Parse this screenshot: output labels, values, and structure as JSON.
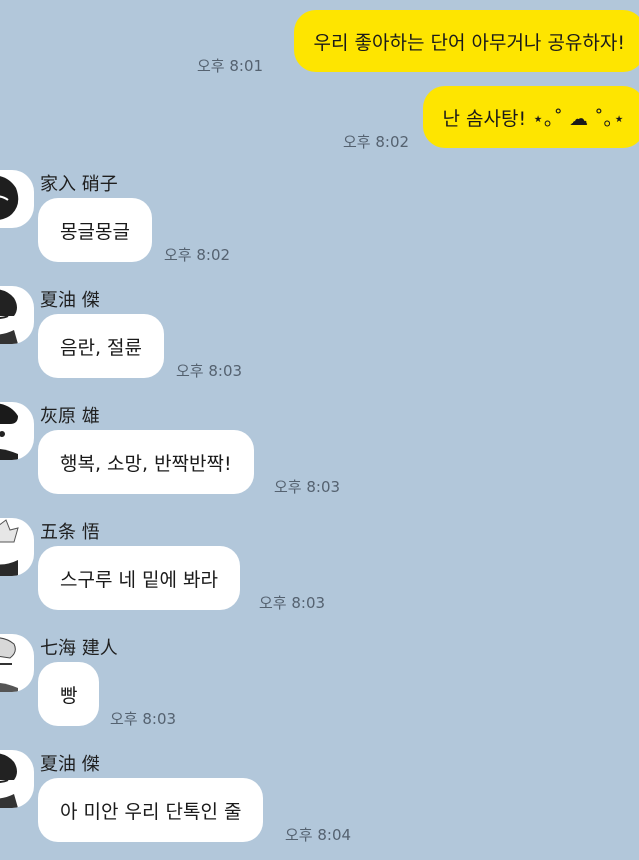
{
  "colors": {
    "background": "#b2c7da",
    "outgoing_bubble": "#fee500",
    "incoming_bubble": "#ffffff"
  },
  "outgoing": [
    {
      "text": "우리 좋아하는 단어 아무거나 공유하자!",
      "time": "오후 8:01"
    },
    {
      "text": "난 솜사탕! ⋆｡˚ ☁︎ ˚｡⋆",
      "time": "오후 8:02"
    }
  ],
  "incoming": [
    {
      "sender": "家入 硝子",
      "text": "몽글몽글",
      "time": "오후 8:02"
    },
    {
      "sender": "夏油 傑",
      "text": "음란, 절륜",
      "time": "오후 8:03"
    },
    {
      "sender": "灰原 雄",
      "text": "행복, 소망, 반짝반짝!",
      "time": "오후 8:03"
    },
    {
      "sender": "五条 悟",
      "text": "스구루 네 밑에 봐라",
      "time": "오후 8:03"
    },
    {
      "sender": "七海 建人",
      "text": "빵",
      "time": "오후 8:03"
    },
    {
      "sender": "夏油 傑",
      "text": "아 미안 우리 단톡인 줄",
      "time": "오후 8:04"
    }
  ]
}
